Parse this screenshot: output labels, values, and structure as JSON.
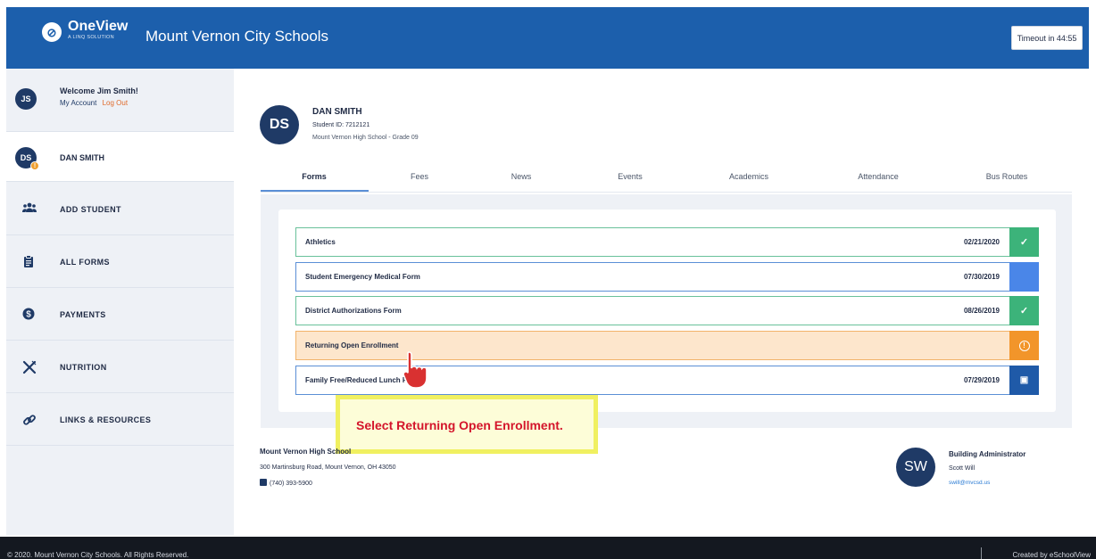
{
  "header": {
    "logo_name": "OneView",
    "logo_tagline": "A LINQ SOLUTION",
    "district_title": "Mount Vernon City Schools",
    "timeout_label": "Timeout in 44:55"
  },
  "sidebar": {
    "user_initials": "JS",
    "welcome_text": "Welcome Jim Smith!",
    "my_account": "My Account",
    "log_out": "Log Out",
    "active_student": {
      "initials": "DS",
      "name": "DAN SMITH",
      "alert_glyph": "!"
    },
    "items": [
      {
        "label": "ADD STUDENT",
        "icon": "users-icon"
      },
      {
        "label": "ALL FORMS",
        "icon": "clipboard-icon"
      },
      {
        "label": "PAYMENTS",
        "icon": "dollar-icon"
      },
      {
        "label": "NUTRITION",
        "icon": "utensils-icon"
      },
      {
        "label": "LINKS & RESOURCES",
        "icon": "link-icon"
      }
    ]
  },
  "student": {
    "initials": "DS",
    "name": "DAN SMITH",
    "id_line": "Student ID: 7212121",
    "school_line": "Mount Vernon High School - Grade 09"
  },
  "tabs": [
    {
      "label": "Forms",
      "active": true
    },
    {
      "label": "Fees",
      "active": false
    },
    {
      "label": "News",
      "active": false
    },
    {
      "label": "Events",
      "active": false
    },
    {
      "label": "Academics",
      "active": false
    },
    {
      "label": "Attendance",
      "active": false
    },
    {
      "label": "Bus Routes",
      "active": false
    }
  ],
  "forms": [
    {
      "name": "Athletics",
      "date": "02/21/2020",
      "status": "completed",
      "status_icon": "check-icon",
      "glyph": "✓"
    },
    {
      "name": "Student Emergency Medical Form",
      "date": "07/30/2019",
      "status": "pending",
      "status_icon": "blank-status-icon",
      "glyph": ""
    },
    {
      "name": "District Authorizations Form",
      "date": "08/26/2019",
      "status": "completed",
      "status_icon": "check-icon",
      "glyph": "✓"
    },
    {
      "name": "Returning Open Enrollment",
      "date": "",
      "status": "action-required",
      "status_icon": "alert-icon",
      "glyph": "!"
    },
    {
      "name": "Family Free/Reduced Lunch Form",
      "date": "07/29/2019",
      "status": "saved",
      "status_icon": "save-icon",
      "glyph": "▣"
    }
  ],
  "colors": {
    "header_blue": "#1c5fac",
    "completed_green": "#3cb37a",
    "pending_blue": "#4a86e8",
    "alert_orange": "#f2952a",
    "alert_row_bg": "#fde6cc",
    "saved_navy": "#1f5aa8",
    "row_border_blue": "#5b8fd6",
    "row_border_green": "#69c19a",
    "callout_text_red": "#d4152b"
  },
  "callout": {
    "text": "Select Returning Open Enrollment."
  },
  "school": {
    "name": "Mount Vernon High School",
    "address": "300 Martinsburg Road, Mount Vernon, OH 43050",
    "phone": "(740) 393-5900"
  },
  "admin": {
    "initials": "SW",
    "title": "Building Administrator",
    "name": "Scott Will",
    "email": "swill@mvcsd.us"
  },
  "footer": {
    "copyright": "© 2020. Mount Vernon City Schools. All Rights Reserved.",
    "credit": "Created by eSchoolView"
  }
}
